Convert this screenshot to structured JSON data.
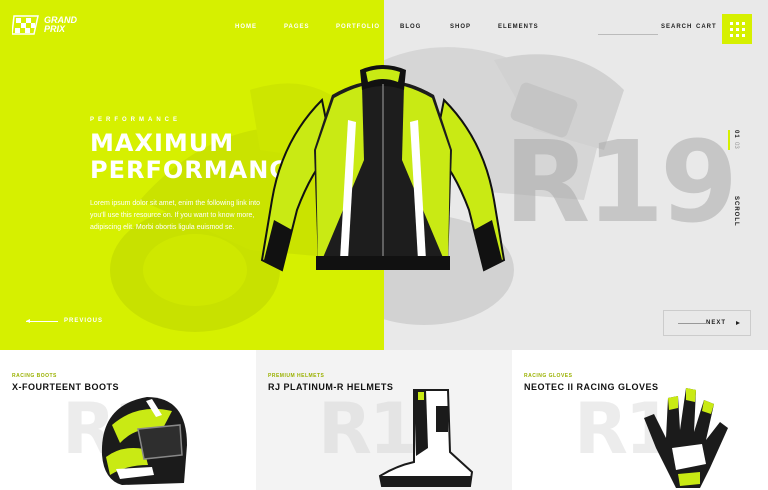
{
  "brand": {
    "line1": "GRAND",
    "line2": "PRIX"
  },
  "nav": {
    "items": [
      "HOME",
      "PAGES",
      "PORTFOLIO",
      "BLOG",
      "SHOP",
      "ELEMENTS"
    ],
    "search_label": "SEARCH",
    "cart_label": "CART"
  },
  "hero": {
    "kicker": "PERFORMANCE",
    "title_line1": "MAXIMUM",
    "title_line2": "PERFORMANCE",
    "description": "Lorem ipsum dolor sit amet, enim the following link into you'll use this resource on. If you want to know more, adipiscing elit. Morbi obortis ligula euismod se.",
    "ghost_text": "R19",
    "pager_current": "01",
    "pager_total": "03",
    "scroll_label": "SCROLL",
    "prev_label": "PREVIOUS",
    "next_label": "NEXT"
  },
  "products": [
    {
      "category": "RACING BOOTS",
      "title": "X-FOURTEENT BOOTS",
      "ghost": "R1",
      "image_icon": "helmet-image"
    },
    {
      "category": "PREMIUM HELMETS",
      "title": "RJ PLATINUM-R HELMETS",
      "ghost": "R1",
      "image_icon": "boot-image"
    },
    {
      "category": "RACING GLOVES",
      "title": "NEOTEC II RACING GLOVES",
      "ghost": "R1",
      "image_icon": "glove-image"
    }
  ],
  "colors": {
    "accent": "#d6f000",
    "dark": "#1a1a1a",
    "grey_panel": "#e9e9e9"
  }
}
